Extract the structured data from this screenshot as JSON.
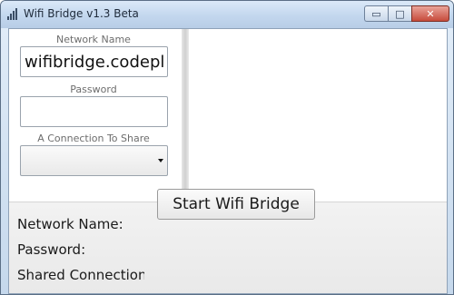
{
  "window": {
    "title": "Wifi Bridge v1.3 Beta",
    "controls": {
      "minimize": "▭",
      "maximize": "□",
      "close": "✕"
    }
  },
  "form": {
    "network_name": {
      "label": "Network Name",
      "value": "wifibridge.codeplex"
    },
    "password": {
      "label": "Password",
      "value": ""
    },
    "connection": {
      "label": "A Connection To Share",
      "selected": ""
    }
  },
  "actions": {
    "start_label": "Start Wifi Bridge"
  },
  "status": {
    "network_name": "Network Name:",
    "password": "Password:",
    "shared_connection": "Shared Connection"
  },
  "icons": {
    "app": "signal-bars-icon",
    "dropdown": "chevron-down-icon"
  },
  "colors": {
    "titlebar": "#c3d7ee",
    "close_button": "#c74b3b",
    "panel_bg": "#eeeeee"
  }
}
